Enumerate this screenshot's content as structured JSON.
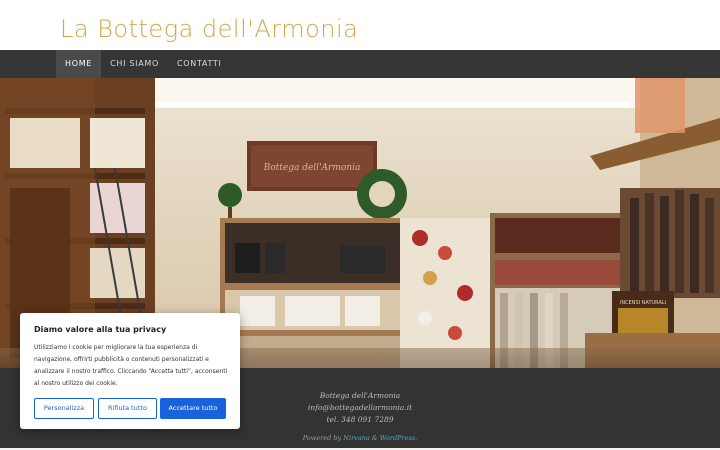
{
  "site": {
    "title": "La Bottega dell'Armonia"
  },
  "nav": {
    "items": [
      "HOME",
      "CHI SIAMO",
      "CONTATTI"
    ],
    "active_index": 0
  },
  "hero": {
    "sign_text": "Bottega dell'Armonia",
    "shelf_sign": "INCENSI NATURALI"
  },
  "footer": {
    "name": "Bottega dell'Armonia",
    "email": "info@bottegadellarmonia.it",
    "phone": "tel. 348 091 7289",
    "powered_prefix": "Powered by",
    "powered_theme": "Nirvana",
    "powered_sep": "&",
    "powered_cms": "WordPress."
  },
  "cookie": {
    "title": "Diamo valore alla tua privacy",
    "text": "Utilizziamo i cookie per migliorare la tua esperienza di navigazione, offrirti pubblicità o contenuti personalizzati e analizzare il nostro traffico. Cliccando “Accetta tutti”, acconsenti al nostro utilizzo dei cookie.",
    "customize_label": "Personalizza",
    "reject_label": "Rifiuta tutto",
    "accept_label": "Accettare tutto",
    "accent_color": "#1863dc"
  },
  "colors": {
    "title": "#cda84c",
    "nav_bg": "#353535",
    "footer_bg": "#333333",
    "link": "#5aa6c4"
  }
}
